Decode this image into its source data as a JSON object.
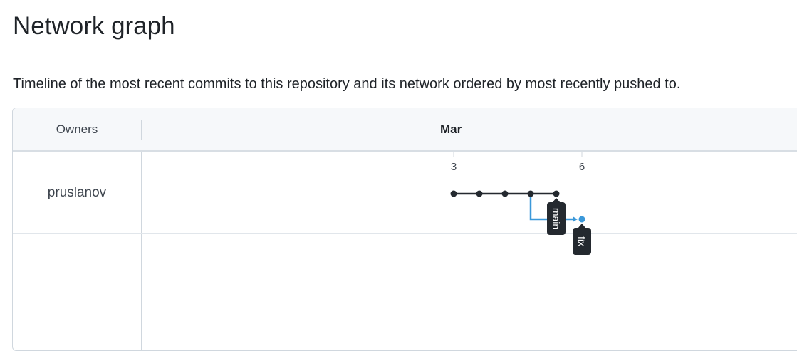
{
  "page": {
    "title": "Network graph",
    "description": "Timeline of the most recent commits to this repository and its network ordered by most recently pushed to."
  },
  "network": {
    "owners_header": "Owners",
    "month": "Mar",
    "days": [
      {
        "label": "3",
        "index": 0
      },
      {
        "label": "6",
        "index": 5
      }
    ],
    "owners": [
      {
        "name": "pruslanov"
      }
    ],
    "commits_main": [
      0,
      1,
      2,
      3,
      4
    ],
    "commits_fix": [
      5
    ],
    "branch_point": 3,
    "branches": [
      {
        "name": "main",
        "color": "#24292f",
        "tip": 4
      },
      {
        "name": "fix",
        "color": "#3b98d9",
        "tip": 5
      }
    ]
  }
}
